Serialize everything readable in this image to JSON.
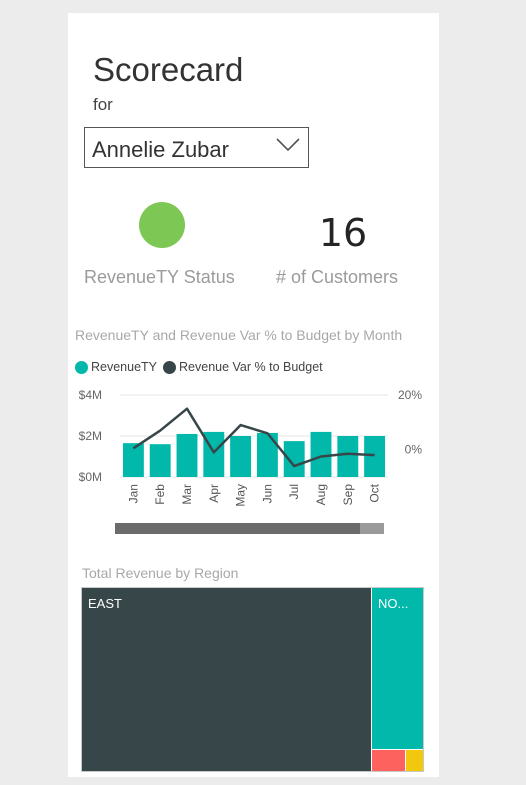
{
  "scorecard": {
    "title": "Scorecard",
    "subtitle": "for",
    "selected_person": "Annelie Zubar"
  },
  "kpis": {
    "status_label": "RevenueTY Status",
    "status_color": "#7dc855",
    "customers_label": "# of Customers",
    "customers_value": "16"
  },
  "chart_data": {
    "type": "bar",
    "title": "RevenueTY and Revenue Var % to Budget by Month",
    "categories": [
      "Jan",
      "Feb",
      "Mar",
      "Apr",
      "May",
      "Jun",
      "Jul",
      "Aug",
      "Sep",
      "Oct"
    ],
    "series": [
      {
        "name": "RevenueTY",
        "type": "bar",
        "axis": "left",
        "color": "#01b8aa",
        "values": [
          1.65,
          1.6,
          2.1,
          2.2,
          2.0,
          2.15,
          1.75,
          2.2,
          2.0,
          2.0
        ]
      },
      {
        "name": "Revenue Var % to Budget",
        "type": "line",
        "axis": "right",
        "color": "#374649",
        "values": [
          0.5,
          7,
          15,
          -1,
          9,
          6,
          -6,
          -2.5,
          -1.5,
          -2
        ]
      }
    ],
    "left_axis": {
      "ticks": [
        "$4M",
        "$2M",
        "$0M"
      ],
      "ylim": [
        0,
        4
      ]
    },
    "right_axis": {
      "ticks": [
        "20%",
        "0%"
      ],
      "ylim": [
        -10,
        20
      ]
    },
    "grid": true,
    "legend_position": "top-left"
  },
  "treemap": {
    "title": "Total Revenue by Region",
    "tiles": [
      {
        "label": "EAST",
        "color": "#374649"
      },
      {
        "label": "NO...",
        "color": "#01b8aa"
      },
      {
        "label": "",
        "color": "#fd625e"
      },
      {
        "label": "",
        "color": "#f2c80f"
      }
    ]
  },
  "colors": {
    "accent": "#01b8aa",
    "dark": "#374649",
    "scrollbar": "#6b6b6b"
  }
}
